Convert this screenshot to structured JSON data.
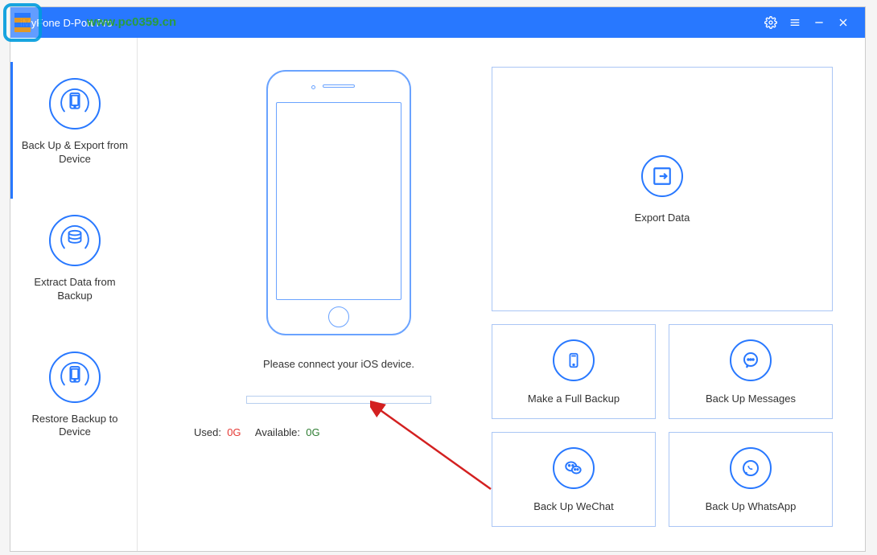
{
  "titlebar": {
    "title": "iMyFone D-Port Pro"
  },
  "sidebar": {
    "items": [
      {
        "label": "Back Up & Export from Device"
      },
      {
        "label": "Extract Data from Backup"
      },
      {
        "label": "Restore Backup to Device"
      }
    ]
  },
  "device": {
    "connect_prompt": "Please connect your iOS device.",
    "used_label": "Used:",
    "used_value": "0G",
    "avail_label": "Available:",
    "avail_value": "0G"
  },
  "cards": {
    "export": "Export Data",
    "full_backup": "Make a Full Backup",
    "messages": "Back Up Messages",
    "wechat": "Back Up WeChat",
    "whatsapp": "Back Up WhatsApp"
  },
  "watermark": {
    "url": "www.pc0359.cn"
  }
}
